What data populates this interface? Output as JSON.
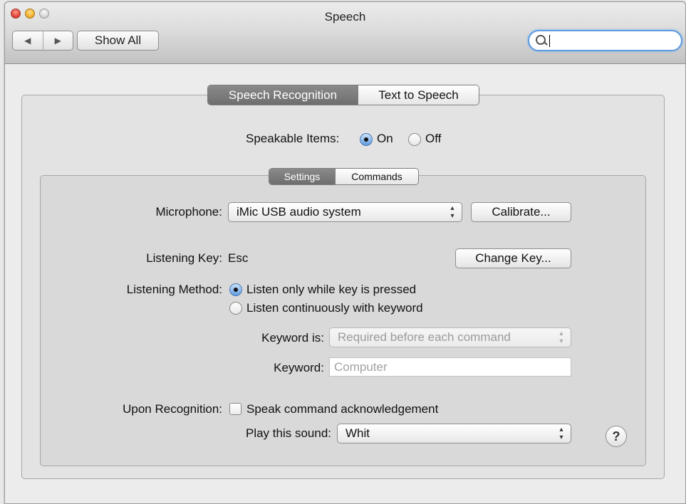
{
  "window": {
    "title": "Speech"
  },
  "toolbar": {
    "back_glyph": "◀",
    "forward_glyph": "▶",
    "show_all_label": "Show All",
    "search_value": ""
  },
  "tabs": [
    {
      "label": "Speech Recognition",
      "selected": true
    },
    {
      "label": "Text to Speech",
      "selected": false
    }
  ],
  "speakable_items": {
    "label": "Speakable Items:",
    "options": [
      {
        "label": "On",
        "selected": true
      },
      {
        "label": "Off",
        "selected": false
      }
    ]
  },
  "subtabs": [
    {
      "label": "Settings",
      "selected": true
    },
    {
      "label": "Commands",
      "selected": false
    }
  ],
  "microphone": {
    "label": "Microphone:",
    "value": "iMic USB audio system",
    "calibrate_label": "Calibrate..."
  },
  "listening_key": {
    "label": "Listening Key:",
    "value": "Esc",
    "change_label": "Change Key..."
  },
  "listening_method": {
    "label": "Listening Method:",
    "options": [
      {
        "label": "Listen only while key is pressed",
        "selected": true
      },
      {
        "label": "Listen continuously with keyword",
        "selected": false
      }
    ]
  },
  "keyword_is": {
    "label": "Keyword is:",
    "value": "Required before each command",
    "enabled": false
  },
  "keyword": {
    "label": "Keyword:",
    "placeholder": "Computer",
    "enabled": false
  },
  "upon_recognition": {
    "label": "Upon Recognition:",
    "checkbox_label": "Speak command acknowledgement",
    "checked": false
  },
  "sound": {
    "label": "Play this sound:",
    "value": "Whit"
  },
  "help": {
    "glyph": "?"
  },
  "popup_arrows": "▴▾"
}
